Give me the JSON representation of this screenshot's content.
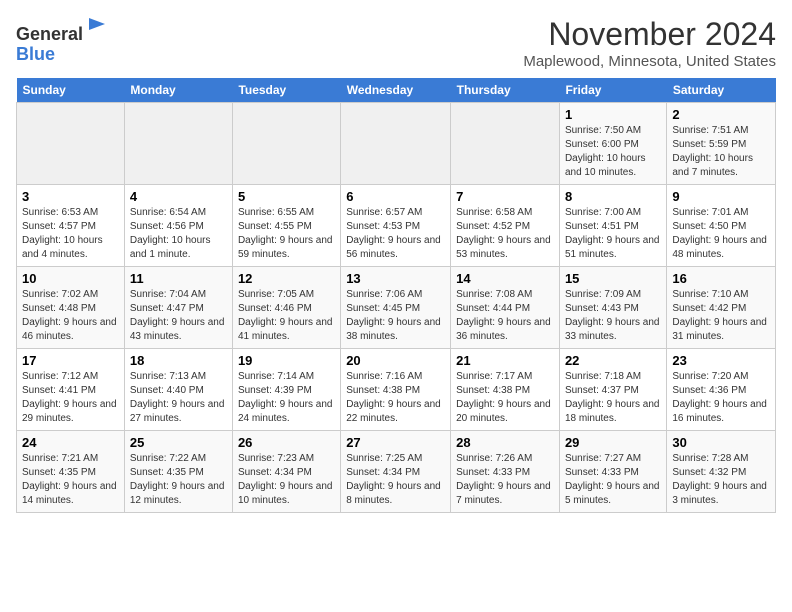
{
  "header": {
    "logo_line1": "General",
    "logo_line2": "Blue",
    "title": "November 2024",
    "subtitle": "Maplewood, Minnesota, United States"
  },
  "days_of_week": [
    "Sunday",
    "Monday",
    "Tuesday",
    "Wednesday",
    "Thursday",
    "Friday",
    "Saturday"
  ],
  "weeks": [
    [
      {
        "day": "",
        "info": ""
      },
      {
        "day": "",
        "info": ""
      },
      {
        "day": "",
        "info": ""
      },
      {
        "day": "",
        "info": ""
      },
      {
        "day": "",
        "info": ""
      },
      {
        "day": "1",
        "info": "Sunrise: 7:50 AM\nSunset: 6:00 PM\nDaylight: 10 hours and 10 minutes."
      },
      {
        "day": "2",
        "info": "Sunrise: 7:51 AM\nSunset: 5:59 PM\nDaylight: 10 hours and 7 minutes."
      }
    ],
    [
      {
        "day": "3",
        "info": "Sunrise: 6:53 AM\nSunset: 4:57 PM\nDaylight: 10 hours and 4 minutes."
      },
      {
        "day": "4",
        "info": "Sunrise: 6:54 AM\nSunset: 4:56 PM\nDaylight: 10 hours and 1 minute."
      },
      {
        "day": "5",
        "info": "Sunrise: 6:55 AM\nSunset: 4:55 PM\nDaylight: 9 hours and 59 minutes."
      },
      {
        "day": "6",
        "info": "Sunrise: 6:57 AM\nSunset: 4:53 PM\nDaylight: 9 hours and 56 minutes."
      },
      {
        "day": "7",
        "info": "Sunrise: 6:58 AM\nSunset: 4:52 PM\nDaylight: 9 hours and 53 minutes."
      },
      {
        "day": "8",
        "info": "Sunrise: 7:00 AM\nSunset: 4:51 PM\nDaylight: 9 hours and 51 minutes."
      },
      {
        "day": "9",
        "info": "Sunrise: 7:01 AM\nSunset: 4:50 PM\nDaylight: 9 hours and 48 minutes."
      }
    ],
    [
      {
        "day": "10",
        "info": "Sunrise: 7:02 AM\nSunset: 4:48 PM\nDaylight: 9 hours and 46 minutes."
      },
      {
        "day": "11",
        "info": "Sunrise: 7:04 AM\nSunset: 4:47 PM\nDaylight: 9 hours and 43 minutes."
      },
      {
        "day": "12",
        "info": "Sunrise: 7:05 AM\nSunset: 4:46 PM\nDaylight: 9 hours and 41 minutes."
      },
      {
        "day": "13",
        "info": "Sunrise: 7:06 AM\nSunset: 4:45 PM\nDaylight: 9 hours and 38 minutes."
      },
      {
        "day": "14",
        "info": "Sunrise: 7:08 AM\nSunset: 4:44 PM\nDaylight: 9 hours and 36 minutes."
      },
      {
        "day": "15",
        "info": "Sunrise: 7:09 AM\nSunset: 4:43 PM\nDaylight: 9 hours and 33 minutes."
      },
      {
        "day": "16",
        "info": "Sunrise: 7:10 AM\nSunset: 4:42 PM\nDaylight: 9 hours and 31 minutes."
      }
    ],
    [
      {
        "day": "17",
        "info": "Sunrise: 7:12 AM\nSunset: 4:41 PM\nDaylight: 9 hours and 29 minutes."
      },
      {
        "day": "18",
        "info": "Sunrise: 7:13 AM\nSunset: 4:40 PM\nDaylight: 9 hours and 27 minutes."
      },
      {
        "day": "19",
        "info": "Sunrise: 7:14 AM\nSunset: 4:39 PM\nDaylight: 9 hours and 24 minutes."
      },
      {
        "day": "20",
        "info": "Sunrise: 7:16 AM\nSunset: 4:38 PM\nDaylight: 9 hours and 22 minutes."
      },
      {
        "day": "21",
        "info": "Sunrise: 7:17 AM\nSunset: 4:38 PM\nDaylight: 9 hours and 20 minutes."
      },
      {
        "day": "22",
        "info": "Sunrise: 7:18 AM\nSunset: 4:37 PM\nDaylight: 9 hours and 18 minutes."
      },
      {
        "day": "23",
        "info": "Sunrise: 7:20 AM\nSunset: 4:36 PM\nDaylight: 9 hours and 16 minutes."
      }
    ],
    [
      {
        "day": "24",
        "info": "Sunrise: 7:21 AM\nSunset: 4:35 PM\nDaylight: 9 hours and 14 minutes."
      },
      {
        "day": "25",
        "info": "Sunrise: 7:22 AM\nSunset: 4:35 PM\nDaylight: 9 hours and 12 minutes."
      },
      {
        "day": "26",
        "info": "Sunrise: 7:23 AM\nSunset: 4:34 PM\nDaylight: 9 hours and 10 minutes."
      },
      {
        "day": "27",
        "info": "Sunrise: 7:25 AM\nSunset: 4:34 PM\nDaylight: 9 hours and 8 minutes."
      },
      {
        "day": "28",
        "info": "Sunrise: 7:26 AM\nSunset: 4:33 PM\nDaylight: 9 hours and 7 minutes."
      },
      {
        "day": "29",
        "info": "Sunrise: 7:27 AM\nSunset: 4:33 PM\nDaylight: 9 hours and 5 minutes."
      },
      {
        "day": "30",
        "info": "Sunrise: 7:28 AM\nSunset: 4:32 PM\nDaylight: 9 hours and 3 minutes."
      }
    ]
  ]
}
